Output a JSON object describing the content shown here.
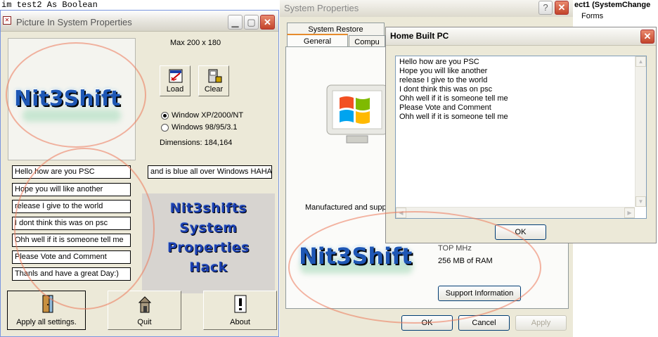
{
  "background": {
    "code_line": "im test2 As Boolean",
    "right_title": "ect1 (SystemChange",
    "right_sub": "Forms"
  },
  "win1": {
    "title": "Picture In System Properties",
    "max_label": "Max 200 x 180",
    "logo_text": "Nit3Shift",
    "load_label": "Load",
    "clear_label": "Clear",
    "radio_xp": "Window XP/2000/NT",
    "radio_98": "Windows 98/95/3.1",
    "radio_selected": "xp",
    "dimensions": "Dimensions: 184,164",
    "info_lines": [
      "Hello how are you PSC",
      "Hope you will like another",
      "release I give to the world",
      "I dont think this was on psc",
      "Ohh well if it is someone tell me",
      "Please Vote and Comment",
      "Thanls and have a great Day:)"
    ],
    "extra_line": "and is blue all over Windows HAHA",
    "hack_title": [
      "Nit3shifts",
      "System",
      "Properties",
      "Hack"
    ],
    "apply_label": "Apply all settings.",
    "quit_label": "Quit",
    "about_label": "About"
  },
  "win2": {
    "title": "System Properties",
    "tab_top": "System Restore",
    "tab_general": "General",
    "tab_computer": "Compu",
    "manufactured": "Manufactured and supp",
    "cpu_partial": "TOP MHz",
    "ram": "256 MB of RAM",
    "support_label": "Support Information",
    "logo_text": "Nit3Shift",
    "ok_label": "OK",
    "cancel_label": "Cancel",
    "apply_label": "Apply"
  },
  "win3": {
    "title": "Home Built PC",
    "memo_lines": [
      "Hello how are you PSC",
      "Hope you will like another",
      "release I give to the world",
      "I dont think this was on psc",
      "Ohh well if it is someone tell me",
      "Please Vote and Comment",
      "Ohh well if it is someone tell me"
    ],
    "ok_label": "OK"
  }
}
